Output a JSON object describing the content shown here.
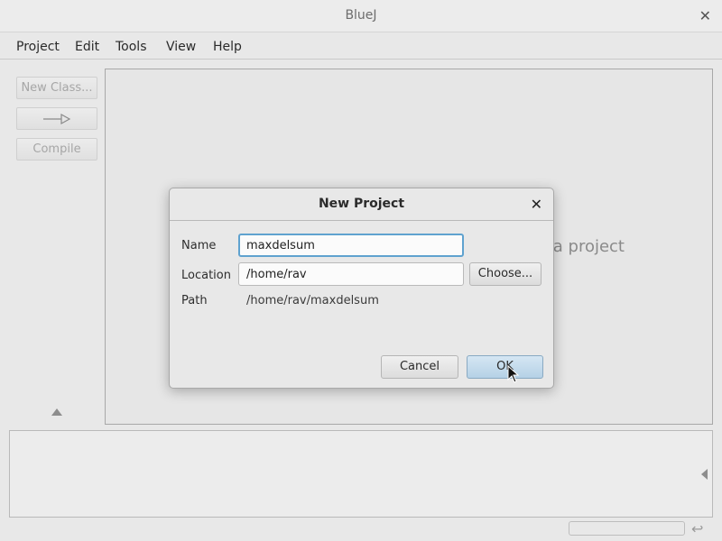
{
  "window": {
    "title": "BlueJ"
  },
  "menu": [
    "Project",
    "Edit",
    "Tools",
    "View",
    "Help"
  ],
  "left_panel": {
    "new_class_label": "New Class...",
    "compile_label": "Compile"
  },
  "canvas": {
    "hint_text": "a project"
  },
  "dialog": {
    "title": "New Project",
    "name_label": "Name",
    "name_value": "maxdelsum",
    "location_label": "Location",
    "location_value": "/home/rav",
    "choose_label": "Choose...",
    "path_label": "Path",
    "path_value": "/home/rav/maxdelsum",
    "cancel_label": "Cancel",
    "ok_label": "OK"
  },
  "icons": {
    "window_close": "close-icon",
    "dialog_close": "close-icon",
    "inheritance_arrow": "inheritance-arrow-icon",
    "collapse_up": "triangle-up-icon",
    "expand_left": "triangle-left-icon",
    "return": "return-icon"
  },
  "colors": {
    "focus_accent": "#5fa2cf",
    "default_button": "#b5d1e6"
  }
}
